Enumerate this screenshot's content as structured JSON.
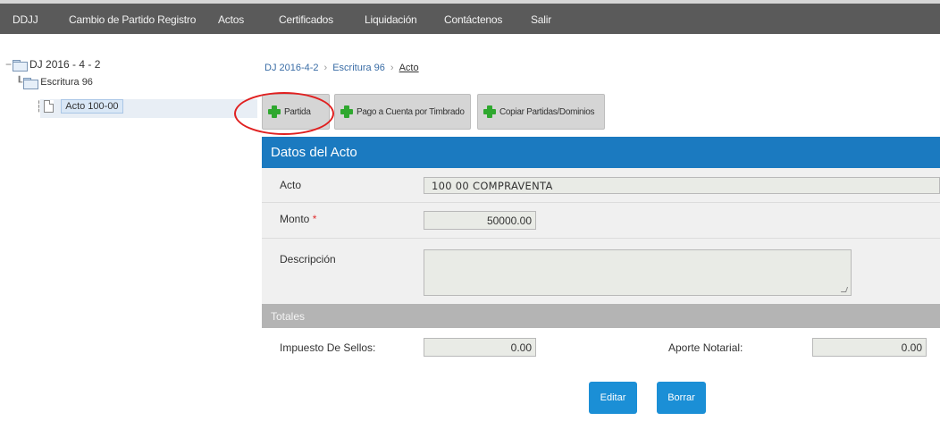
{
  "nav": {
    "items": [
      {
        "label": "DDJJ"
      },
      {
        "label": "Cambio de Partido Registro"
      },
      {
        "label": "Actos"
      },
      {
        "label": "Certificados"
      },
      {
        "label": "Liquidación"
      },
      {
        "label": "Contáctenos"
      },
      {
        "label": "Salir"
      }
    ]
  },
  "tree": {
    "root": "DJ 2016 - 4 - 2",
    "child": "Escritura 96",
    "leaf": "Acto 100-00"
  },
  "breadcrumb": {
    "items": [
      "DJ 2016-4-2",
      "Escritura 96",
      "Acto"
    ]
  },
  "actions": {
    "partida": "Partida",
    "pago": "Pago a Cuenta por Timbrado",
    "copiar": "Copiar Partidas/Dominios"
  },
  "panel": {
    "title": "Datos del Acto",
    "acto_label": "Acto",
    "acto_value": "100 00 COMPRAVENTA",
    "monto_label": "Monto",
    "monto_required": "*",
    "monto_value": "50000.00",
    "descripcion_label": "Descripción",
    "descripcion_value": "",
    "totales_label": "Totales",
    "impuesto_label": "Impuesto De Sellos:",
    "impuesto_value": "0.00",
    "aporte_label": "Aporte Notarial:",
    "aporte_value": "0.00"
  },
  "buttons": {
    "editar": "Editar",
    "borrar": "Borrar"
  },
  "colors": {
    "nav_bg": "#5a5a5a",
    "header_blue": "#1b7ac0",
    "button_blue": "#1b8fd6",
    "plus_green": "#2fa82f",
    "annotation_red": "#e02020"
  }
}
